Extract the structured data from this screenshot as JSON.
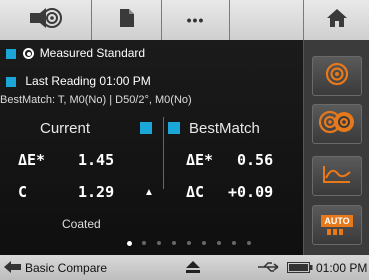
{
  "toolbar": {
    "buttons": [
      {
        "icon": "measure-target-icon"
      },
      {
        "icon": "document-icon"
      },
      {
        "icon": "more-icon",
        "label": "•••"
      },
      {
        "icon": "home-icon"
      }
    ]
  },
  "main": {
    "standard_label": "Measured Standard",
    "last_reading": "Last Reading 01:00 PM",
    "bestmatch_info": "BestMatch: T, M0(No) | D50/2°, M0(No)",
    "headers": {
      "current": "Current",
      "bestmatch": "BestMatch"
    },
    "current": {
      "de_label": "ΔE*",
      "de_value": "1.45",
      "c_label": "C",
      "c_value": "1.29",
      "c_arrow": "▲",
      "note": "Coated"
    },
    "bestmatch": {
      "de_label": "ΔE*",
      "de_value": "0.56",
      "dc_label": "ΔC",
      "dc_value": "+0.09"
    },
    "page_dots": {
      "count": 9,
      "active": 0
    }
  },
  "sidebar": {
    "buttons": [
      {
        "icon": "target-icon"
      },
      {
        "icon": "compare-targets-icon"
      },
      {
        "icon": "trend-graph-icon"
      },
      {
        "icon": "auto-icon",
        "label": "AUTO"
      }
    ]
  },
  "status": {
    "mode": "Basic Compare",
    "time": "01:00 PM"
  },
  "colors": {
    "accent": "#1aa6d6",
    "orange": "#e8791a"
  }
}
